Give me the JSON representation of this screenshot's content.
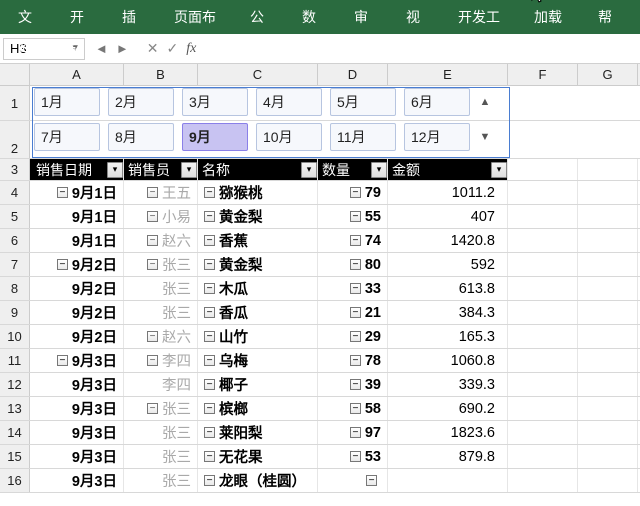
{
  "ribbon": {
    "tabs": [
      "文件",
      "开始",
      "插入",
      "页面布局",
      "公式",
      "数据",
      "审阅",
      "视图",
      "开发工具",
      "加载项",
      "帮助"
    ]
  },
  "name_box": {
    "value": "H3"
  },
  "columns": [
    "A",
    "B",
    "C",
    "D",
    "E",
    "F",
    "G"
  ],
  "row_headers": [
    1,
    2,
    3,
    4,
    5,
    6,
    7,
    8,
    9,
    10,
    11,
    12,
    13,
    14,
    15,
    16
  ],
  "slicer": {
    "months_row1": [
      "1月",
      "2月",
      "3月",
      "4月",
      "5月",
      "6月"
    ],
    "months_row2": [
      "7月",
      "8月",
      "9月",
      "10月",
      "11月",
      "12月"
    ],
    "selected": "9月"
  },
  "table": {
    "headers": {
      "date": "销售日期",
      "seller": "销售员",
      "name": "名称",
      "qty": "数量",
      "amount": "金额"
    },
    "rows": [
      {
        "date": "9月1日",
        "date_bold": true,
        "date_grp": true,
        "seller": "王五",
        "seller_grp": true,
        "seller_grey": true,
        "name": "猕猴桃",
        "qty": 79,
        "amount": "1011.2"
      },
      {
        "date": "9月1日",
        "date_bold": true,
        "date_grp": false,
        "seller": "小易",
        "seller_grp": true,
        "seller_grey": true,
        "name": "黄金梨",
        "qty": 55,
        "amount": "407"
      },
      {
        "date": "9月1日",
        "date_bold": true,
        "date_grp": false,
        "seller": "赵六",
        "seller_grp": true,
        "seller_grey": true,
        "name": "香蕉",
        "qty": 74,
        "amount": "1420.8"
      },
      {
        "date": "9月2日",
        "date_bold": true,
        "date_grp": true,
        "seller": "张三",
        "seller_grp": true,
        "seller_grey": true,
        "name": "黄金梨",
        "qty": 80,
        "amount": "592"
      },
      {
        "date": "9月2日",
        "date_bold": true,
        "date_grp": false,
        "seller": "张三",
        "seller_grp": false,
        "seller_grey": true,
        "name": "木瓜",
        "qty": 33,
        "amount": "613.8"
      },
      {
        "date": "9月2日",
        "date_bold": true,
        "date_grp": false,
        "seller": "张三",
        "seller_grp": false,
        "seller_grey": true,
        "name": "香瓜",
        "qty": 21,
        "amount": "384.3"
      },
      {
        "date": "9月2日",
        "date_bold": true,
        "date_grp": false,
        "seller": "赵六",
        "seller_grp": true,
        "seller_grey": true,
        "name": "山竹",
        "qty": 29,
        "amount": "165.3"
      },
      {
        "date": "9月3日",
        "date_bold": true,
        "date_grp": true,
        "seller": "李四",
        "seller_grp": true,
        "seller_grey": true,
        "name": "乌梅",
        "qty": 78,
        "amount": "1060.8"
      },
      {
        "date": "9月3日",
        "date_bold": true,
        "date_grp": false,
        "seller": "李四",
        "seller_grp": false,
        "seller_grey": true,
        "name": "椰子",
        "qty": 39,
        "amount": "339.3"
      },
      {
        "date": "9月3日",
        "date_bold": true,
        "date_grp": false,
        "seller": "张三",
        "seller_grp": true,
        "seller_grey": true,
        "name": "槟榔",
        "qty": 58,
        "amount": "690.2"
      },
      {
        "date": "9月3日",
        "date_bold": true,
        "date_grp": false,
        "seller": "张三",
        "seller_grp": false,
        "seller_grey": true,
        "name": "莱阳梨",
        "qty": 97,
        "amount": "1823.6"
      },
      {
        "date": "9月3日",
        "date_bold": true,
        "date_grp": false,
        "seller": "张三",
        "seller_grp": false,
        "seller_grey": true,
        "name": "无花果",
        "qty": 53,
        "amount": "879.8"
      },
      {
        "date": "9月3日",
        "date_bold": true,
        "date_grp": false,
        "seller": "张三",
        "seller_grp": false,
        "seller_grey": true,
        "name": "龙眼（桂圆）",
        "qty": "",
        "amount": ""
      }
    ]
  }
}
